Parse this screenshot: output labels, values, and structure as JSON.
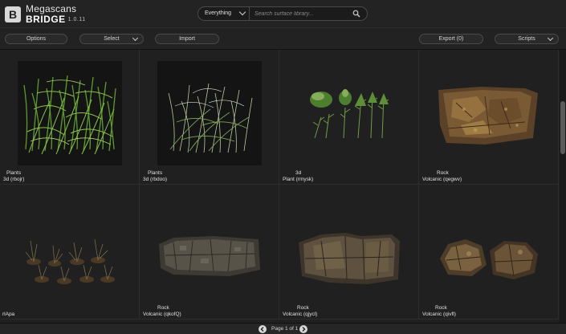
{
  "app": {
    "logo_letter": "B",
    "name_top": "Megascans",
    "name_bottom": "BRIDGE",
    "version": "1.0.11"
  },
  "search": {
    "scope": "Everything",
    "placeholder": "Search surface library...",
    "value": ""
  },
  "toolbar": {
    "options": "Options",
    "select": "Select",
    "import": "Import",
    "export": "Export (0)",
    "scripts": "Scripts"
  },
  "assets": [
    {
      "line1": "Plants",
      "line2": "3d (rbojr)",
      "thumb": "grass-dense"
    },
    {
      "line1": "Plants",
      "line2": "3d (rbdoo)",
      "thumb": "grass-sparse"
    },
    {
      "line1": "3d",
      "line2": "Plant (rmysk)",
      "thumb": "plant-set"
    },
    {
      "line1": "Rock",
      "line2": "Volcanic (qegwv)",
      "thumb": "rock-slab"
    },
    {
      "line1": "",
      "line2": "rlApa",
      "thumb": "dry-grass-set"
    },
    {
      "line1": "Rock",
      "line2": "Volcanic (qkofQ)",
      "thumb": "rock-flat"
    },
    {
      "line1": "Rock",
      "line2": "Volcanic (qjycl)",
      "thumb": "rock-cliff"
    },
    {
      "line1": "Rock",
      "line2": "Volcanic (qivfl)",
      "thumb": "rock-boulders"
    }
  ],
  "pagination": {
    "label": "Page 1 of 1"
  },
  "colors": {
    "background": "#1f1f1f",
    "topbar": "#232323",
    "accent_text": "#e0e0e0"
  }
}
